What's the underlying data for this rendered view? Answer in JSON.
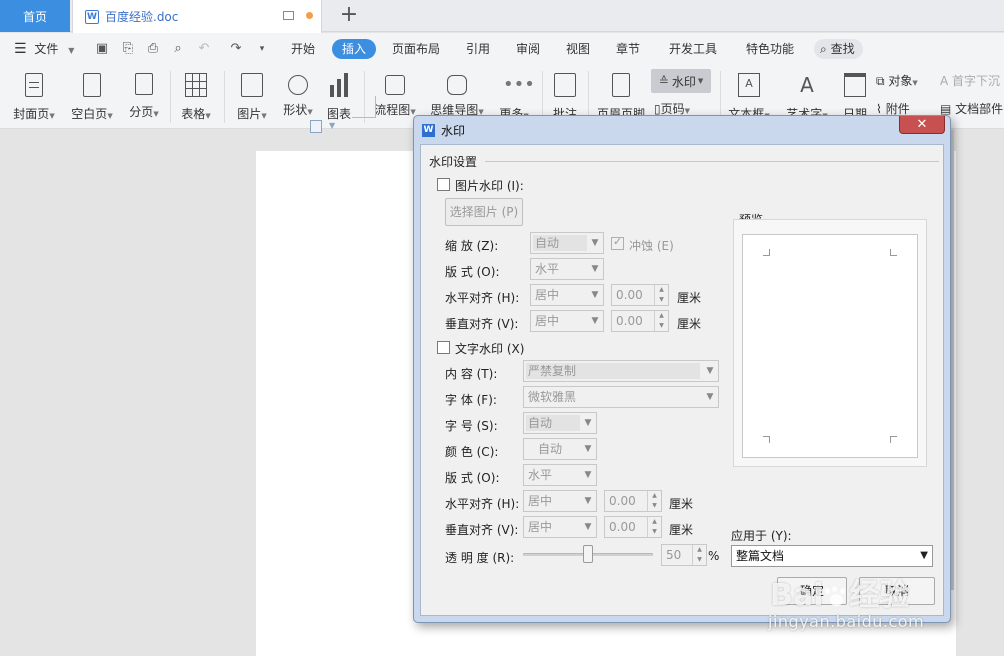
{
  "tabs": {
    "home": "首页",
    "document": "百度经验.doc",
    "new_tab_icon": "+"
  },
  "menu": {
    "file": "文件",
    "items": [
      "开始",
      "插入",
      "页面布局",
      "引用",
      "审阅",
      "视图",
      "章节",
      "开发工具",
      "特色功能"
    ],
    "search": "查找"
  },
  "ribbon": {
    "cover": "封面页",
    "blank": "空白页",
    "break": "分页",
    "table": "表格",
    "picture": "图片",
    "shape": "形状",
    "chart": "图表",
    "flowchart": "流程图",
    "mindmap": "思维导图",
    "more": "更多",
    "comment": "批注",
    "header_footer": "页眉页脚",
    "watermark": "水印",
    "page_number": "页码",
    "textbox": "文本框",
    "wordart": "艺术字",
    "date": "日期",
    "object": "对象",
    "dropcap": "首字下沉",
    "attachment": "附件",
    "doc_parts": "文档部件"
  },
  "dialog": {
    "title": "水印",
    "close_icon": "✕",
    "section": "水印设置",
    "picture_watermark": {
      "label": "图片水印 (I):",
      "choose_button": "选择图片 (P)",
      "scale_label": "缩    放 (Z):",
      "scale_value": "自动",
      "washout_label": "冲蚀 (E)",
      "layout_label": "版    式 (O):",
      "layout_value": "水平",
      "halign_label": "水平对齐 (H):",
      "halign_value": "居中",
      "halign_offset": "0.00",
      "valign_label": "垂直对齐 (V):",
      "valign_value": "居中",
      "valign_offset": "0.00",
      "unit": "厘米"
    },
    "text_watermark": {
      "label": "文字水印 (X)",
      "content_label": "内    容 (T):",
      "content_value": "严禁复制",
      "font_label": "字    体 (F):",
      "font_value": "微软雅黑",
      "size_label": "字    号 (S):",
      "size_value": "自动",
      "color_label": "颜    色 (C):",
      "color_value": "自动",
      "layout_label": "版    式 (O):",
      "layout_value": "水平",
      "halign_label": "水平对齐 (H):",
      "halign_value": "居中",
      "halign_offset": "0.00",
      "valign_label": "垂直对齐 (V):",
      "valign_value": "居中",
      "valign_offset": "0.00",
      "unit": "厘米",
      "transparency_label": "透 明 度 (R):",
      "transparency_value": "50",
      "transparency_unit": "%"
    },
    "preview_label": "预览",
    "apply_label": "应用于 (Y):",
    "apply_value": "整篇文档",
    "ok_button": "确定",
    "cancel_button": "取消"
  },
  "watermark_logo": {
    "brand": "Baidu 经验",
    "url": "jingyan.baidu.com"
  },
  "colors": {
    "accent": "#3c8fe0",
    "close": "#c75050",
    "dialog_frame": "#c9d8ec"
  }
}
